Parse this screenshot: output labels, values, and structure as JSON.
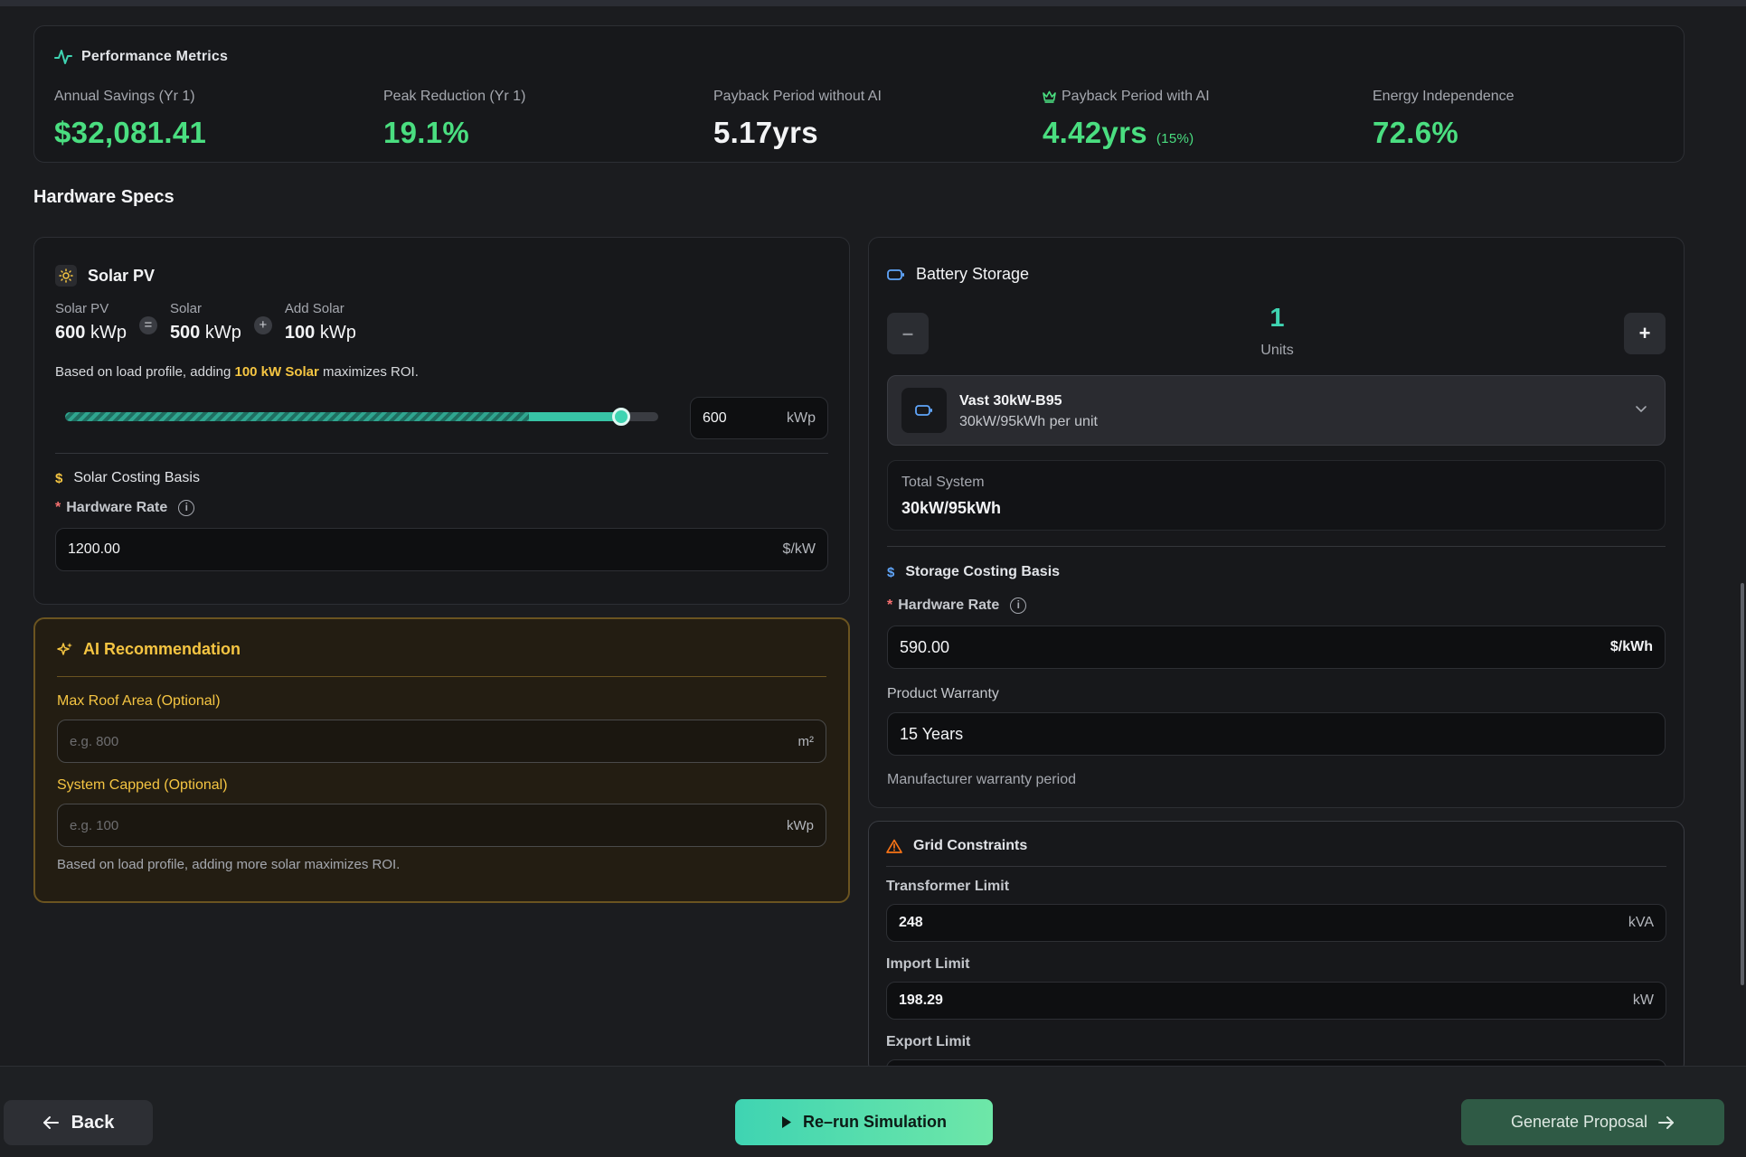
{
  "performance": {
    "title": "Performance Metrics",
    "metrics": [
      {
        "label": "Annual Savings (Yr 1)",
        "value": "$32,081.41"
      },
      {
        "label": "Peak Reduction (Yr 1)",
        "value": "19.1%"
      },
      {
        "label": "Payback Period without AI",
        "value": "5.17yrs"
      },
      {
        "label": "Payback Period with AI",
        "value": "4.42yrs",
        "sub": "(15%)"
      },
      {
        "label": "Energy Independence",
        "value": "72.6%"
      }
    ]
  },
  "hardware": {
    "title": "Hardware Specs",
    "solar": {
      "title": "Solar PV",
      "calc": {
        "total_label": "Solar PV",
        "total_value": "600",
        "total_unit": "kWp",
        "equals": "=",
        "base_label": "Solar",
        "base_value": "500",
        "base_unit": "kWp",
        "plus": "+",
        "add_label": "Add Solar",
        "add_value": "100",
        "add_unit": "kWp"
      },
      "hint_prefix": "Based on load profile, adding ",
      "hint_highlight": "100 kW Solar",
      "hint_suffix": " maximizes ROI.",
      "slider": {
        "min": 0,
        "max": 640,
        "value": 600,
        "base": 500
      },
      "input_value": "600",
      "input_unit": "kWp",
      "costing": {
        "title": "Solar Costing Basis",
        "label": "Hardware Rate",
        "value": "1200.00",
        "unit": "$/kW"
      }
    },
    "ai": {
      "title": "AI Recommendation",
      "roof_label": "Max Roof Area (Optional)",
      "roof_placeholder": "e.g. 800",
      "roof_unit": "m²",
      "cap_label": "System Capped (Optional)",
      "cap_placeholder": "e.g. 100",
      "cap_unit": "kWp",
      "note": "Based on load profile, adding more solar maximizes ROI."
    },
    "battery": {
      "title": "Battery Storage",
      "minus": "–",
      "plus": "+",
      "units_count": "1",
      "units_label": "Units",
      "product_name": "Vast 30kW-B95",
      "product_spec": "30kW/95kWh per unit",
      "total_label": "Total System",
      "total_value": "30kW/95kWh",
      "costing": {
        "title": "Storage Costing Basis",
        "label": "Hardware Rate",
        "value": "590.00",
        "unit": "$/kWh"
      },
      "warranty_label": "Product Warranty",
      "warranty_value": "15 Years",
      "warranty_note": "Manufacturer warranty period"
    },
    "grid": {
      "title": "Grid Constraints",
      "transformer_label": "Transformer Limit",
      "transformer_value": "248",
      "transformer_unit": "kVA",
      "import_label": "Import Limit",
      "import_value": "198.29",
      "import_unit": "kW",
      "export_label": "Export Limit"
    }
  },
  "footer": {
    "back": "Back",
    "rerun": "Re–run Simulation",
    "generate": "Generate Proposal"
  },
  "colors": {
    "accent_teal": "#3fd4b2",
    "positive_green": "#4ade80",
    "ai_gold": "#f5c542",
    "required_red": "#f87171"
  }
}
